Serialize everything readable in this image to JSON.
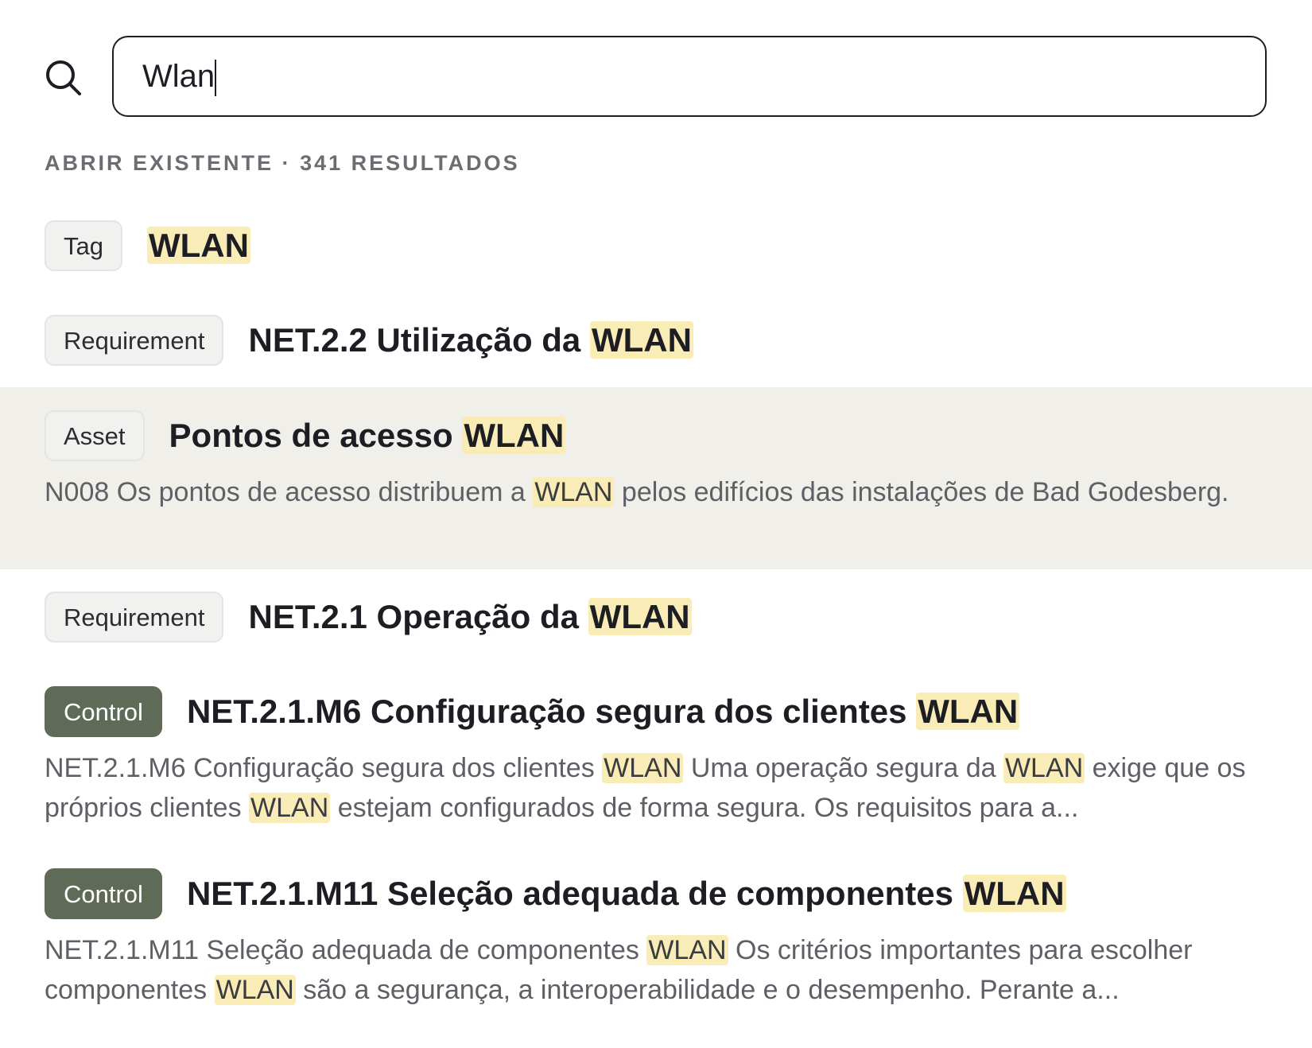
{
  "search": {
    "value": "Wlan",
    "icon": "search-icon"
  },
  "section": {
    "label": "ABRIR EXISTENTE",
    "separator": "·",
    "count": "341 RESULTADOS"
  },
  "colors": {
    "highlight": "#faecb6",
    "active_row": "#f0efea",
    "control_badge": "#5f6b57",
    "default_badge": "#f1f1ef"
  },
  "results": [
    {
      "type": "Tag",
      "title_prefix": "",
      "title_match": "WLAN",
      "description": null
    },
    {
      "type": "Requirement",
      "title_prefix": "NET.2.2 Utilização da ",
      "title_match": "WLAN",
      "description": null
    },
    {
      "type": "Asset",
      "active": true,
      "title_prefix": "Pontos de acesso ",
      "title_match": "WLAN",
      "description": {
        "p1": "N008 Os pontos de acesso distribuem a ",
        "m1": "WLAN",
        "p2": " pelos edifícios das instalações de Bad Godesberg."
      }
    },
    {
      "type": "Requirement",
      "title_prefix": "NET.2.1 Operação da ",
      "title_match": "WLAN",
      "description": null
    },
    {
      "type": "Control",
      "title_prefix": "NET.2.1.M6 Configuração segura dos clientes ",
      "title_match": "WLAN",
      "description": {
        "p1": "NET.2.1.M6 Configuração segura dos clientes ",
        "m1": "WLAN",
        "p2": " Uma operação segura da ",
        "m2": "WLAN",
        "p3": " exige que os próprios clientes ",
        "m3": "WLAN",
        "p4": " estejam configurados de forma segura. Os requisitos para a..."
      }
    },
    {
      "type": "Control",
      "title_prefix": "NET.2.1.M11 Seleção adequada de componentes ",
      "title_match": "WLAN",
      "description": {
        "p1": "NET.2.1.M11 Seleção adequada de componentes ",
        "m1": "WLAN",
        "p2": " Os critérios importantes para escolher componentes ",
        "m2": "WLAN",
        "p3": " são a segurança, a interoperabilidade e o desempenho. Perante a..."
      }
    }
  ]
}
